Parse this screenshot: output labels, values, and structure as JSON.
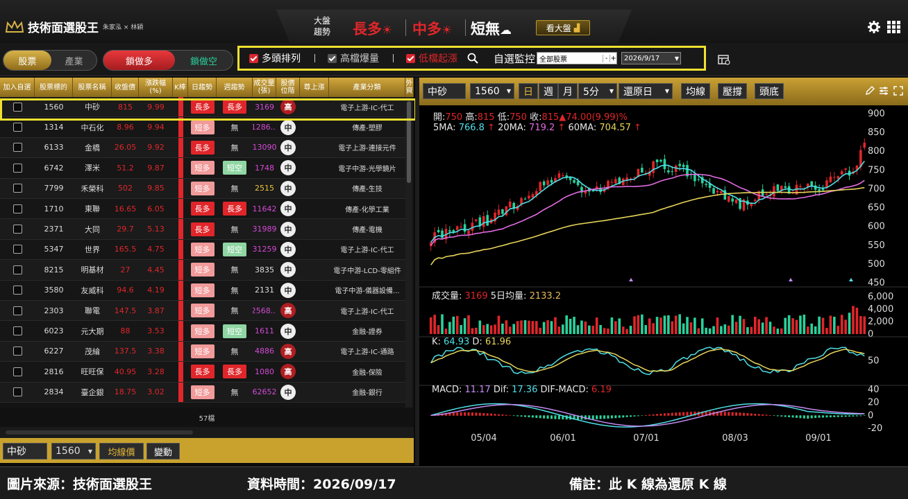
{
  "app": {
    "title": "技術面選股王",
    "authors": "朱家泓 × 林穎"
  },
  "market": {
    "label1": "大盤",
    "label2": "趨勢",
    "long": "長多",
    "mid": "中多",
    "short": "短無",
    "view_btn": "看大盤"
  },
  "colors": {
    "up": "#e0262a",
    "down": "#2ad19b",
    "accent": "#c9a22e",
    "highlight": "#f0e130"
  },
  "tabs": {
    "stock": "股票",
    "industry": "產業",
    "lock_long": "鎖做多",
    "lock_short": "鎖做空"
  },
  "filters": {
    "f1": "多頭排列",
    "f1_checked": true,
    "f2": "高檔爆量",
    "f2_checked": false,
    "f3": "低檔起漲",
    "f3_checked": true,
    "watch": "自選監控",
    "watch_value": "全部股票",
    "date_value": "2026/9/17"
  },
  "table": {
    "headers": [
      "加入自選",
      "股票標的",
      "股票名稱",
      "收盤價",
      "漲跌幅\n(%)",
      "K棒",
      "日趨勢",
      "週趨勢",
      "成交量\n(張)",
      "股價\n位階",
      "尊上漲",
      "產業分類",
      "外資"
    ],
    "rows": [
      {
        "code": "1560",
        "name": "中砂",
        "close": "815",
        "chg": "9.99",
        "day": "長多",
        "week": "長多",
        "vol": "3169",
        "pos": "高",
        "ind": "電子上游-IC-代工"
      },
      {
        "code": "1314",
        "name": "中石化",
        "close": "8.96",
        "chg": "9.94",
        "day": "短多",
        "week": "無",
        "vol": "1286...",
        "pos": "中",
        "ind": "傳產-塑膠"
      },
      {
        "code": "6133",
        "name": "金橋",
        "close": "26.05",
        "chg": "9.92",
        "day": "長多",
        "week": "無",
        "vol": "13090",
        "pos": "中",
        "ind": "電子上游-連接元件"
      },
      {
        "code": "6742",
        "name": "澤米",
        "close": "51.2",
        "chg": "9.87",
        "day": "短多",
        "week": "短空",
        "vol": "1748",
        "pos": "中",
        "ind": "電子中游-光學鏡片"
      },
      {
        "code": "7799",
        "name": "禾榮科",
        "close": "502",
        "chg": "9.85",
        "day": "短多",
        "week": "無",
        "vol": "2515",
        "pos": "中",
        "ind": "傳產-生技"
      },
      {
        "code": "1710",
        "name": "東聯",
        "close": "16.65",
        "chg": "6.05",
        "day": "長多",
        "week": "長多",
        "vol": "11642",
        "pos": "中",
        "ind": "傳產-化學工業"
      },
      {
        "code": "2371",
        "name": "大同",
        "close": "29.7",
        "chg": "5.13",
        "day": "長多",
        "week": "無",
        "vol": "31989",
        "pos": "中",
        "ind": "傳產-電機"
      },
      {
        "code": "5347",
        "name": "世界",
        "close": "165.5",
        "chg": "4.75",
        "day": "短多",
        "week": "短空",
        "vol": "31259",
        "pos": "中",
        "ind": "電子上游-IC-代工"
      },
      {
        "code": "8215",
        "name": "明基材",
        "close": "27",
        "chg": "4.45",
        "day": "短多",
        "week": "無",
        "vol": "3835",
        "pos": "中",
        "ind": "電子中游-LCD-零組件"
      },
      {
        "code": "3580",
        "name": "友威科",
        "close": "94.6",
        "chg": "4.19",
        "day": "短多",
        "week": "無",
        "vol": "2131",
        "pos": "中",
        "ind": "電子中游-儀器設備..."
      },
      {
        "code": "2303",
        "name": "聯電",
        "close": "147.5",
        "chg": "3.87",
        "day": "短多",
        "week": "無",
        "vol": "2568...",
        "pos": "高",
        "ind": "電子上游-IC-代工"
      },
      {
        "code": "6023",
        "name": "元大期",
        "close": "88",
        "chg": "3.53",
        "day": "短多",
        "week": "短空",
        "vol": "1611",
        "pos": "中",
        "ind": "金融-證券"
      },
      {
        "code": "6227",
        "name": "茂綸",
        "close": "137.5",
        "chg": "3.38",
        "day": "短多",
        "week": "無",
        "vol": "4886",
        "pos": "高",
        "ind": "電子上游-IC-通路"
      },
      {
        "code": "2816",
        "name": "旺旺保",
        "close": "40.95",
        "chg": "3.28",
        "day": "長多",
        "week": "長多",
        "vol": "1080",
        "pos": "高",
        "ind": "金融-保險"
      },
      {
        "code": "2834",
        "name": "臺企銀",
        "close": "18.75",
        "chg": "3.02",
        "day": "短多",
        "week": "無",
        "vol": "62652",
        "pos": "中",
        "ind": "金融-銀行"
      }
    ],
    "count": "57檔"
  },
  "bottom": {
    "name": "中砂",
    "code": "1560",
    "btn1": "均線價",
    "btn2": "變動"
  },
  "chart_toolbar": {
    "name": "中砂",
    "code": "1560",
    "day": "日",
    "week": "週",
    "month": "月",
    "min": "5分",
    "restore": "還原日",
    "ma": "均線",
    "sr": "壓撐",
    "top": "頭底"
  },
  "chart_text": {
    "open_l": "開:",
    "open": "750",
    "high_l": "高:",
    "high": "815",
    "low_l": "低:",
    "low": "750",
    "close_l": "收:",
    "close": "815▲74.00(9.99)%",
    "ma5_l": "5MA:",
    "ma5": "766.8",
    "ma20_l": "20MA:",
    "ma20": "719.2",
    "ma60_l": "60MA:",
    "ma60": "704.57",
    "vol_l": "成交量:",
    "vol": "3169",
    "vol5_l": "5日均量:",
    "vol5": "2133.2",
    "k_l": "K:",
    "k": "64.93",
    "d_l": "D:",
    "d": "61.96",
    "macd_l": "MACD:",
    "macd": "11.17",
    "dif_l": "Dif:",
    "dif": "17.36",
    "dm_l": "DIF-MACD:",
    "dm": "6.19"
  },
  "chart_data": {
    "type": "candlestick",
    "x_ticks": [
      "05/04",
      "06/01",
      "07/01",
      "08/03",
      "09/01"
    ],
    "price_ticks": [
      450,
      500,
      550,
      600,
      650,
      700,
      750,
      800,
      850,
      900
    ],
    "volume_ticks": [
      "0",
      "2,000",
      "4,000",
      "6,000"
    ],
    "kd_ticks": [
      "50"
    ],
    "macd_ticks": [
      "-20",
      "0",
      "20",
      "40"
    ],
    "last_bar": {
      "open": 750,
      "high": 815,
      "low": 750,
      "close": 815
    },
    "ma": {
      "5MA": 766.8,
      "20MA": 719.2,
      "60MA": 704.57
    },
    "volume": 3169,
    "volume_5d": 2133.2,
    "kd": {
      "K": 64.93,
      "D": 61.96
    },
    "macd": {
      "MACD": 11.17,
      "Dif": 17.36,
      "DIF-MACD": 6.19
    }
  },
  "footer": {
    "source": "圖片來源：技術面選股王",
    "date": "資料時間：2026/09/17",
    "note": "備註：此 K 線為還原 K 線"
  }
}
